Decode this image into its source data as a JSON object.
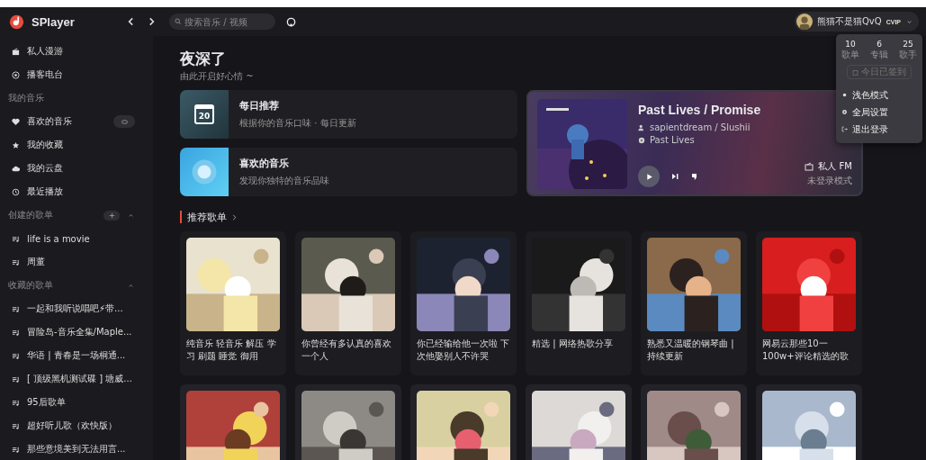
{
  "app": {
    "name": "SPlayer"
  },
  "search": {
    "placeholder": "搜索音乐 / 视频"
  },
  "user": {
    "name": "熊猫不是猫QvQ",
    "badge": "CVIP",
    "menu_open": true
  },
  "user_menu": {
    "stats": [
      {
        "value": "10",
        "label": "歌单"
      },
      {
        "value": "6",
        "label": "专辑"
      },
      {
        "value": "25",
        "label": "歌手"
      }
    ],
    "sign_in": {
      "label": "今日已签到",
      "disabled": true
    },
    "items": [
      "浅色模式",
      "全局设置",
      "退出登录"
    ]
  },
  "sidebar": {
    "nav": [
      "私人漫游",
      "播客电台"
    ],
    "my_music": {
      "title": "我的音乐",
      "items": [
        "喜欢的音乐",
        "我的收藏",
        "我的云盘",
        "最近播放"
      ]
    },
    "created": {
      "title": "创建的歌单",
      "expanded": true,
      "items": [
        "life is a movie",
        "周董"
      ]
    },
    "collected": {
      "title": "收藏的歌单",
      "expanded": true,
      "items": [
        "一起和我听说唱吧⚡带...",
        "冒险岛-音乐全集/Maple...",
        "华语 | 青春是一场桐通...",
        "[ 顶级黑机测试碟 ] 塘威...",
        "95后歌单",
        "超好听儿歌（欢快版）",
        "那些意境美到无法用言..."
      ]
    }
  },
  "greeting": {
    "title": "夜深了",
    "subtitle": "由此开启好心情 ~"
  },
  "daily": {
    "title": "每日推荐",
    "subtitle": "根据你的音乐口味 · 每日更新",
    "date": "20"
  },
  "liked": {
    "title": "喜欢的音乐",
    "subtitle": "发现你独特的音乐品味"
  },
  "fm": {
    "song": "Past Lives / Promise",
    "artists": "sapientdream / Slushii",
    "album": "Past Lives",
    "label": "私人 FM",
    "mode": "未登录模式"
  },
  "playlists": {
    "title": "推荐歌单",
    "items": [
      {
        "kind": "playlist",
        "title": "纯音乐 轻音乐 解压 学习 刷题 睡觉 御用"
      },
      {
        "kind": "playlist",
        "title": "你曾经有多认真的喜欢一个人"
      },
      {
        "kind": "playlist",
        "title": "你已经输给他一次啦 下次他娶别人不许哭"
      },
      {
        "kind": "playlist",
        "title": "精选 | 网络热歌分享"
      },
      {
        "kind": "playlist",
        "title": "熟悉又温暖的钢琴曲 | 持续更新"
      },
      {
        "kind": "playlist",
        "title": "网易云那些10一100w+评论精选的歌"
      },
      {
        "kind": "picture"
      },
      {
        "kind": "picture"
      },
      {
        "kind": "picture"
      },
      {
        "kind": "picture"
      },
      {
        "kind": "picture"
      },
      {
        "kind": "picture"
      }
    ]
  }
}
